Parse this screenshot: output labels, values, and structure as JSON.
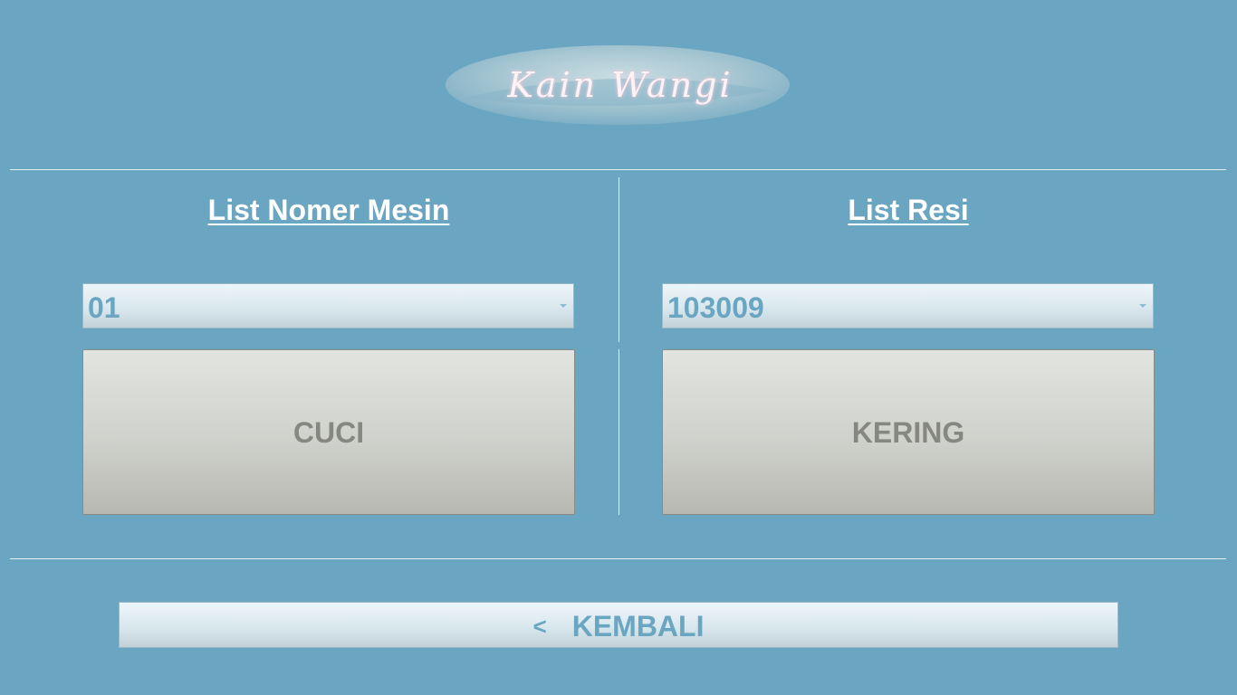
{
  "app": {
    "logo_text": "Kain Wangi"
  },
  "machine_panel": {
    "heading": "List Nomer Mesin",
    "selected_value": "01",
    "action_label": "CUCI"
  },
  "receipt_panel": {
    "heading": "List Resi",
    "selected_value": "103009",
    "action_label": "KERING"
  },
  "footer": {
    "back_icon": "<",
    "back_label": "KEMBALI"
  },
  "colors": {
    "background": "#6aa6c2",
    "accent_text": "#6aa6c2",
    "button_text": "#878782",
    "logo_text": "#fbf3f6"
  }
}
